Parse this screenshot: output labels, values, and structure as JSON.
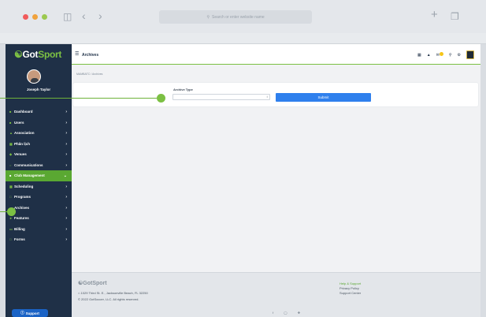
{
  "browser": {
    "url_placeholder": "Search or enter website name",
    "colors": {
      "close": "#f15b5b",
      "minimize": "#f0a23c",
      "zoom": "#9cc94f"
    }
  },
  "sidebar": {
    "brand_prefix": "Got",
    "brand_suffix": "Sport",
    "user_name": "Joseph Taylor",
    "items": [
      {
        "label": "Dashboard",
        "icon": "dashboard-icon"
      },
      {
        "label": "Users",
        "icon": "users-icon"
      },
      {
        "label": "Association",
        "icon": "association-icon"
      },
      {
        "label": "Phân lịch",
        "icon": "calendar-icon"
      },
      {
        "label": "Venues",
        "icon": "venues-icon"
      },
      {
        "label": "Communications",
        "icon": "communications-icon"
      },
      {
        "label": "Club Management",
        "icon": "club-management-icon",
        "active": true
      },
      {
        "label": "Scheduling",
        "icon": "scheduling-icon"
      },
      {
        "label": "Programs",
        "icon": "programs-icon"
      },
      {
        "label": "Archives",
        "icon": "archives-icon"
      },
      {
        "label": "Features",
        "icon": "features-icon"
      },
      {
        "label": "Billing",
        "icon": "billing-icon"
      },
      {
        "label": "Forms",
        "icon": "forms-icon"
      }
    ],
    "support_label": "Support"
  },
  "topbar": {
    "title": "Archives"
  },
  "breadcrumb": {
    "root": "MAMBATC",
    "current": "Archives"
  },
  "archive_form": {
    "type_label": "Archive Type",
    "type_value": "",
    "submit_label": "Submit"
  },
  "footer": {
    "brand_prefix": "Got",
    "brand_suffix": "Sport",
    "address": "1029 Third St. E., Jacksonville Beach, FL 32250",
    "copyright": "© 2022 GotSoccer, LLC. All rights reserved.",
    "links": [
      "Help & Support",
      "Privacy Policy",
      "Support Center"
    ]
  },
  "colors": {
    "sidebar_bg": "#1f3047",
    "accent_green": "#7cc043",
    "submit_blue": "#2f80ed"
  }
}
